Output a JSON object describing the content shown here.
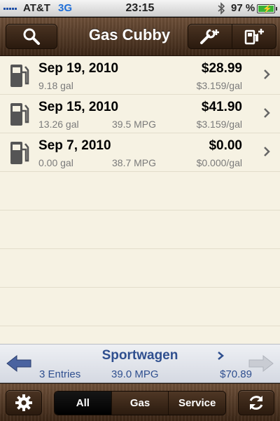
{
  "status_bar": {
    "carrier": "AT&T",
    "network": "3G",
    "time": "23:15",
    "battery_percent": "97 %"
  },
  "nav": {
    "title": "Gas Cubby",
    "left_icon": "search-icon",
    "right_icons": [
      "add-service-icon",
      "add-fuel-icon"
    ]
  },
  "entries": [
    {
      "date": "Sep 19, 2010",
      "price": "$28.99",
      "gallons": "9.18 gal",
      "mpg": "",
      "price_per_gal": "$3.159/gal"
    },
    {
      "date": "Sep 15, 2010",
      "price": "$41.90",
      "gallons": "13.26 gal",
      "mpg": "39.5 MPG",
      "price_per_gal": "$3.159/gal"
    },
    {
      "date": "Sep 7, 2010",
      "price": "$0.00",
      "gallons": "0.00 gal",
      "mpg": "38.7 MPG",
      "price_per_gal": "$0.000/gal"
    }
  ],
  "summary": {
    "vehicle": "Sportwagen",
    "entries": "3 Entries",
    "avg_mpg": "39.0 MPG",
    "total": "$70.89"
  },
  "toolbar": {
    "segments": [
      "All",
      "Gas",
      "Service"
    ],
    "selected_segment": "All",
    "left_icon": "gear-icon",
    "right_icon": "sync-icon"
  },
  "colors": {
    "accent": "#2f4f8f",
    "battery": "#3bb237",
    "network": "#1e6fd9"
  }
}
